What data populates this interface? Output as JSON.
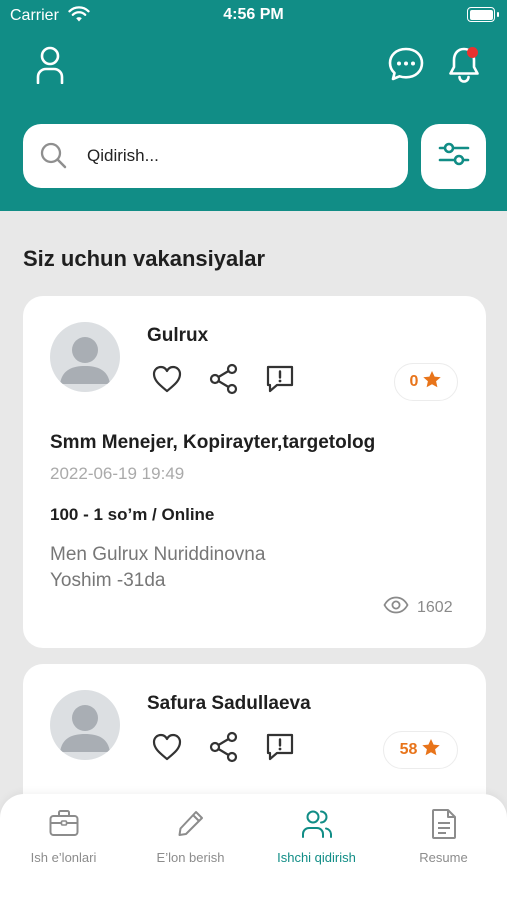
{
  "status_bar": {
    "carrier": "Carrier",
    "time": "4:56 PM"
  },
  "header": {
    "profile_icon": "user-icon",
    "chat_icon": "chat-icon",
    "notifications_icon": "bell-icon",
    "has_unread_notifications": true
  },
  "search": {
    "placeholder": "Qidirish...",
    "value": "",
    "filter_icon": "sliders-icon"
  },
  "section": {
    "title": "Siz uchun vakansiyalar"
  },
  "cards": [
    {
      "name": "Gulrux",
      "rating": "0",
      "job_title": "Smm Menejer, Kopirayter,targetolog",
      "date": "2022-06-19 19:49",
      "salary": "100 - 1 so’m / Online",
      "description_line1": "Men Gulrux Nuriddinovna",
      "description_line2": "Yoshim -31da",
      "views": "1602"
    },
    {
      "name": "Safura Sadullaeva",
      "rating": "58"
    }
  ],
  "tabs": [
    {
      "label": "Ish e’lonlari",
      "icon": "briefcase-icon",
      "active": false
    },
    {
      "label": "E’lon berish",
      "icon": "pencil-icon",
      "active": false
    },
    {
      "label": "Ishchi qidirish",
      "icon": "users-icon",
      "active": true
    },
    {
      "label": "Resume",
      "icon": "document-icon",
      "active": false
    }
  ],
  "colors": {
    "primary": "#118d86",
    "background": "#e8e8e8",
    "rating_orange": "#e8741a",
    "notification_dot": "#e8322f",
    "inactive_tab": "#8c8c8c"
  }
}
